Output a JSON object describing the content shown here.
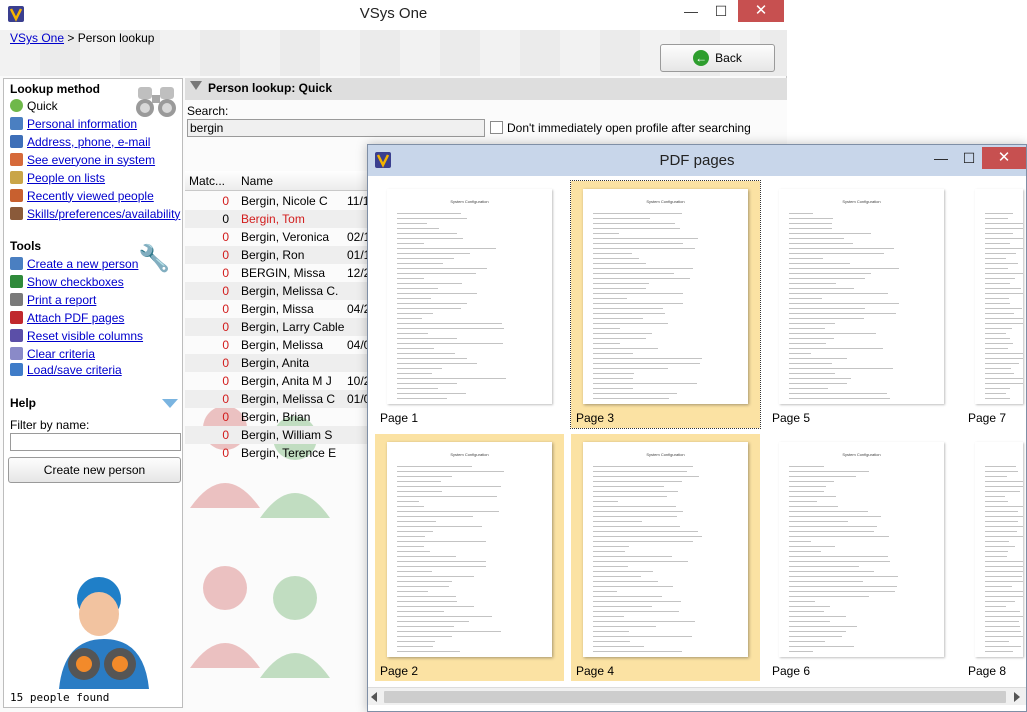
{
  "window": {
    "title": "VSys One",
    "min_glyph": "—",
    "max_glyph": "☐",
    "close_glyph": "✕"
  },
  "breadcrumb": {
    "root": "VSys One",
    "separator": ">",
    "current": "Person lookup"
  },
  "back_button": {
    "label": "Back",
    "icon": "green-left-arrow-icon"
  },
  "left_panel": {
    "lookup_heading": "Lookup method",
    "lookup_items": [
      {
        "label": "Quick",
        "icon": "quick-globe-icon",
        "link": false
      },
      {
        "label": "Personal information",
        "icon": "person-icon",
        "link": true
      },
      {
        "label": "Address, phone, e-mail",
        "icon": "address-book-icon",
        "link": true
      },
      {
        "label": "See everyone in system",
        "icon": "group-icon",
        "link": true
      },
      {
        "label": "People on lists",
        "icon": "list-people-icon",
        "link": true
      },
      {
        "label": "Recently viewed people",
        "icon": "recent-people-icon",
        "link": true
      },
      {
        "label": "Skills/preferences/availability",
        "icon": "skills-person-icon",
        "link": true
      }
    ],
    "tools_heading": "Tools",
    "tools_items": [
      {
        "label": "Create a new person",
        "icon": "new-person-icon"
      },
      {
        "label": "Show checkboxes",
        "icon": "checkbox-icon"
      },
      {
        "label": "Print a report",
        "icon": "printer-icon"
      },
      {
        "label": "Attach PDF pages",
        "icon": "attach-pdf-icon"
      },
      {
        "label": "Reset visible columns",
        "icon": "reset-columns-icon"
      },
      {
        "label": "Clear criteria",
        "icon": "eraser-icon"
      },
      {
        "label": "Load/save criteria",
        "icon": "load-save-icon"
      }
    ],
    "help_heading": "Help",
    "filter_label": "Filter by name:",
    "filter_value": "",
    "create_button": "Create new person",
    "status": "15 people found"
  },
  "lookup": {
    "title": "Person lookup: Quick",
    "search_label": "Search:",
    "search_value": "bergin",
    "checkbox_label": "Don't immediately open profile after searching",
    "checkbox_checked": false
  },
  "results": {
    "columns": [
      "Matc...",
      "Name"
    ],
    "rows": [
      {
        "match": "0",
        "name": "Bergin, Nicole C",
        "date": "11/1",
        "highlight": false
      },
      {
        "match": "0",
        "name": "Bergin, Tom",
        "date": "",
        "highlight": true
      },
      {
        "match": "0",
        "name": "Bergin, Veronica",
        "date": "02/1",
        "highlight": false
      },
      {
        "match": "0",
        "name": "Bergin, Ron",
        "date": "01/1",
        "highlight": false
      },
      {
        "match": "0",
        "name": "BERGIN, Missa",
        "date": "12/2",
        "highlight": false
      },
      {
        "match": "0",
        "name": "Bergin, Melissa C.",
        "date": "",
        "highlight": false
      },
      {
        "match": "0",
        "name": "Bergin, Missa",
        "date": "04/2",
        "highlight": false
      },
      {
        "match": "0",
        "name": "Bergin, Larry Cable",
        "date": "",
        "highlight": false
      },
      {
        "match": "0",
        "name": "Bergin, Melissa",
        "date": "04/0",
        "highlight": false
      },
      {
        "match": "0",
        "name": "Bergin, Anita",
        "date": "",
        "highlight": false
      },
      {
        "match": "0",
        "name": "Bergin, Anita M J",
        "date": "10/2",
        "highlight": false
      },
      {
        "match": "0",
        "name": "Bergin, Melissa C",
        "date": "01/0",
        "highlight": false
      },
      {
        "match": "0",
        "name": "Bergin, Brian",
        "date": "",
        "highlight": false
      },
      {
        "match": "0",
        "name": "Bergin, William S",
        "date": "",
        "highlight": false
      },
      {
        "match": "0",
        "name": "Bergin, Terence E",
        "date": "",
        "highlight": false
      }
    ]
  },
  "pdf_dialog": {
    "title": "PDF pages",
    "pages": [
      {
        "label": "Page 1",
        "heading": "System Configuration",
        "selected": false
      },
      {
        "label": "Page 3",
        "heading": "System Configuration",
        "selected": true
      },
      {
        "label": "Page 5",
        "heading": "System Configuration",
        "selected": false
      },
      {
        "label": "Page 7",
        "heading": "",
        "selected": false
      },
      {
        "label": "Page 2",
        "heading": "System Configuration",
        "selected": true
      },
      {
        "label": "Page 4",
        "heading": "System Configuration",
        "selected": true
      },
      {
        "label": "Page 6",
        "heading": "System Configuration",
        "selected": false
      },
      {
        "label": "Page 8",
        "heading": "",
        "selected": false
      }
    ]
  },
  "colors": {
    "link": "#0000cc",
    "highlight_row_text": "#d21c1c",
    "selected_page_bg": "#fbe2a3",
    "dialog_titlebar": "#c8d6ea",
    "close_button": "#c75050"
  }
}
